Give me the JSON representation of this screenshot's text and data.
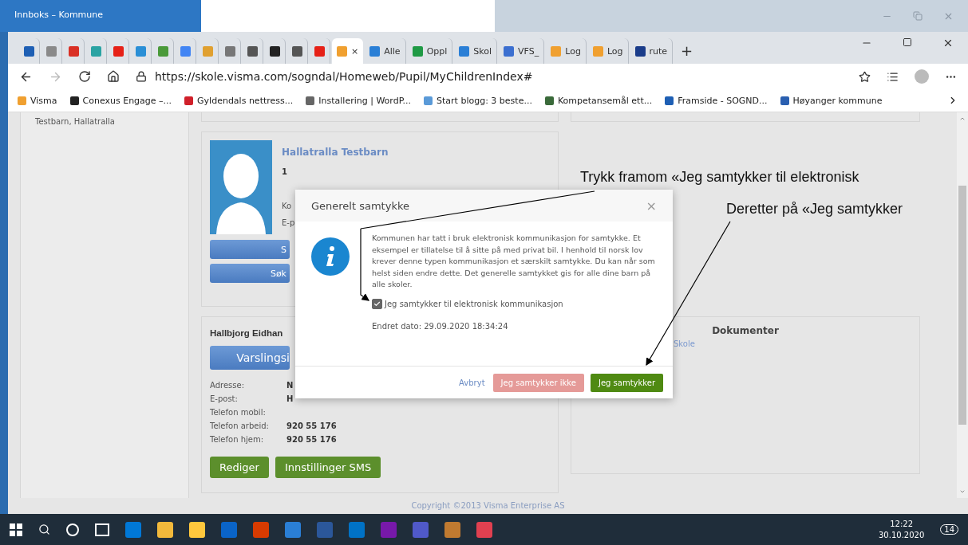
{
  "outer_window": {
    "title": "Innboks – Kommune"
  },
  "browser": {
    "tabs": [
      {
        "color": "#1e5fb4",
        "selected": false
      },
      {
        "color": "#8a8a8a",
        "selected": false
      },
      {
        "color": "#d93025",
        "selected": false
      },
      {
        "color": "#2aa3a3",
        "selected": false
      },
      {
        "color": "#e62117",
        "selected": false
      },
      {
        "color": "#2a8fd6",
        "selected": false
      },
      {
        "color": "#4a9a3a",
        "selected": false
      },
      {
        "color": "#4285f4",
        "selected": false
      },
      {
        "color": "#e0a030",
        "selected": false
      },
      {
        "color": "#777777",
        "selected": false
      },
      {
        "color": "#555555",
        "selected": false
      },
      {
        "color": "#222222",
        "selected": false
      },
      {
        "color": "#555555",
        "selected": false
      },
      {
        "color": "#e62117",
        "selected": false
      },
      {
        "color": "#f0a030",
        "selected": true,
        "close": "×"
      },
      {
        "color": "#2a7fd6",
        "selected": false,
        "label": "Alle"
      },
      {
        "color": "#1f9a45",
        "selected": false,
        "label": "Oppl"
      },
      {
        "color": "#2a7fd6",
        "selected": false,
        "label": "Skol"
      },
      {
        "color": "#3b6fd0",
        "selected": false,
        "label": "VFS_"
      },
      {
        "color": "#f0a030",
        "selected": false,
        "label": "Log"
      },
      {
        "color": "#f0a030",
        "selected": false,
        "label": "Log"
      },
      {
        "color": "#1a3c8a",
        "selected": false,
        "label": "rute"
      }
    ],
    "new_tab": "+",
    "url": "https://skole.visma.com/sogndal/Homeweb/Pupil/MyChildrenIndex#",
    "bookmarks": [
      {
        "label": "Visma",
        "color": "#f0a030"
      },
      {
        "label": "Conexus Engage –...",
        "color": "#222222"
      },
      {
        "label": "Gyldendals nettress...",
        "color": "#d0202a"
      },
      {
        "label": "Installering | WordP...",
        "color": "#666666"
      },
      {
        "label": "Start blogg: 3 beste...",
        "color": "#5a9ad8"
      },
      {
        "label": "Kompetansemål ett...",
        "color": "#3a6a3a"
      },
      {
        "label": "Framside - SOGND...",
        "color": "#1e5fb4"
      },
      {
        "label": "Høyanger kommune",
        "color": "#2a5fb0"
      }
    ]
  },
  "sidebar": {
    "items": [
      "Testbarn, Hallatralla"
    ]
  },
  "child_card": {
    "name": "Hallatralla Testbarn",
    "grade": "1",
    "labels": [
      "Ko",
      "E-p"
    ],
    "buttons": [
      "S",
      "Søk"
    ]
  },
  "parent_card": {
    "name": "Hallbjorg Eidhan",
    "notify_button": "Varslingsi",
    "rows": [
      {
        "label": "Adresse:",
        "value": "N"
      },
      {
        "label": "E-post:",
        "value": "H"
      },
      {
        "label": "Telefon mobil:"
      },
      {
        "label": "Telefon arbeid:",
        "value": "920 55 176"
      },
      {
        "label": "Telefon hjem:",
        "value": "920 55 176"
      }
    ],
    "buttons": [
      "Rediger",
      "Innstillinger SMS"
    ]
  },
  "documents_card": {
    "title": "Dokumenter",
    "links": [
      "Skole"
    ]
  },
  "modal": {
    "title": "Generelt samtykke",
    "close": "×",
    "text": "Kommunen har tatt i bruk elektronisk kommunikasjon for samtykke. Et eksempel er tillatelse til å sitte på med privat bil. I henhold til norsk lov krever denne typen kommunikasjon et særskilt samtykke. Du kan når som helst siden endre dette. Det generelle samtykket gis for alle dine barn på alle skoler.",
    "checkbox": {
      "label": "Jeg samtykker til elektronisk kommunikasjon",
      "checked": true
    },
    "changed": "Endret dato: 29.09.2020 18:34:24",
    "cancel": "Avbryt",
    "decline": "Jeg samtykker ikke",
    "accept": "Jeg samtykker"
  },
  "annotations": [
    "Trykk framom «Jeg samtykker til elektronisk",
    "Deretter på «Jeg samtykker"
  ],
  "copyright": "Copyright ©2013 Visma Enterprise AS",
  "taskbar": {
    "apps": [
      {
        "color": "#0078d7"
      },
      {
        "color": "#f2b93b"
      },
      {
        "color": "#ffc83d"
      },
      {
        "color": "#0a64c8"
      },
      {
        "color": "#d83b01"
      },
      {
        "color": "#2a7fd6"
      },
      {
        "color": "#2b579a"
      },
      {
        "color": "#0072c6"
      },
      {
        "color": "#7719aa"
      },
      {
        "color": "#5059c9"
      },
      {
        "color": "#c07a30"
      },
      {
        "color": "#e04050"
      }
    ],
    "time": "12:22",
    "date": "30.10.2020",
    "notifications": "14"
  }
}
